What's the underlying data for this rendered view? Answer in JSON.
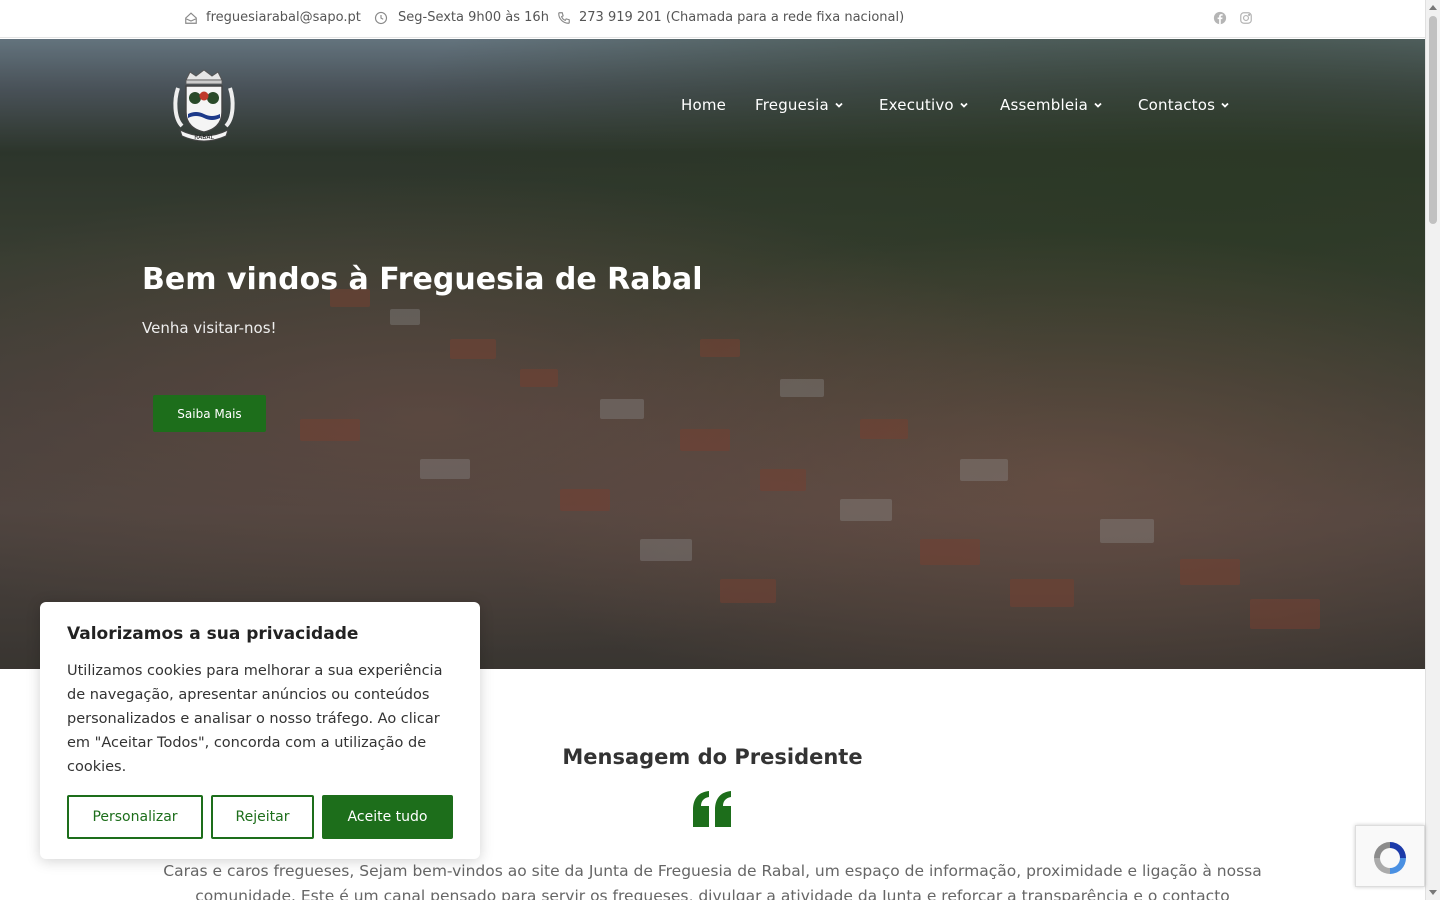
{
  "topbar": {
    "email": "freguesiarabal@sapo.pt",
    "hours": "Seg-Sexta 9h00 às 16h",
    "phone": "273 919 201 (Chamada para a rede fixa nacional)"
  },
  "nav": {
    "home": "Home",
    "freguesia": "Freguesia",
    "executivo": "Executivo",
    "assembleia": "Assembleia",
    "contactos": "Contactos"
  },
  "logo": {
    "text": "RABAL"
  },
  "hero": {
    "title": "Bem vindos à Freguesia de Rabal",
    "subtitle": "Venha visitar-nos!",
    "button": "Saiba Mais"
  },
  "president": {
    "title": "Mensagem do Presidente",
    "text": "Caras e caros fregueses, Sejam bem-vindos ao site da Junta de Freguesia de Rabal, um espaço de informação, proximidade e ligação à nossa comunidade. Este é um canal pensado para servir os fregueses, divulgar a atividade da Junta e reforçar a transparência e o contacto"
  },
  "cookie": {
    "title": "Valorizamos a sua privacidade",
    "body": "Utilizamos cookies para melhorar a sua experiência de navegação, apresentar anúncios ou conteúdos personalizados e analisar o nosso tráfego. Ao clicar em \"Aceitar Todos\", concorda com a utilização de cookies.",
    "customize": "Personalizar",
    "reject": "Rejeitar",
    "accept": "Aceite tudo"
  },
  "colors": {
    "brand_green": "#1d6e1b"
  },
  "icons": [
    "home-icon",
    "clock-icon",
    "phone-icon",
    "facebook-icon",
    "instagram-icon",
    "chevron-down-icon",
    "quote-icon",
    "recaptcha-icon"
  ]
}
